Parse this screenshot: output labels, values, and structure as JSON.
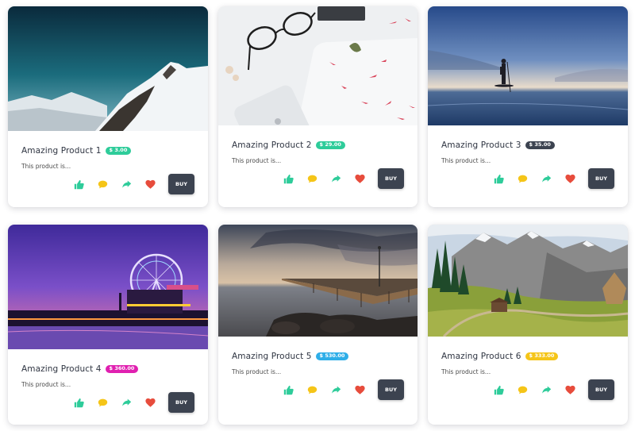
{
  "colors": {
    "like": "#2ecc9a",
    "comment": "#f5c518",
    "share": "#2ecc9a",
    "favorite": "#e74c3c",
    "buy_button": "#3c4350"
  },
  "icons": [
    "thumbs-up-icon",
    "comment-icon",
    "share-icon",
    "heart-icon"
  ],
  "products": [
    {
      "title": "Amazing Product 1",
      "price": "$ 3.00",
      "badge_color": "#2ecc9a",
      "description": "This product is...",
      "buy_label": "BUY"
    },
    {
      "title": "Amazing Product 2",
      "price": "$ 29.00",
      "badge_color": "#2ecc9a",
      "description": "This product is...",
      "buy_label": "BUY"
    },
    {
      "title": "Amazing Product 3",
      "price": "$ 35.00",
      "badge_color": "#3c4350",
      "description": "This product is...",
      "buy_label": "BUY"
    },
    {
      "title": "Amazing Product 4",
      "price": "$ 360.00",
      "badge_color": "#e020b0",
      "description": "This product is...",
      "buy_label": "BUY"
    },
    {
      "title": "Amazing Product 5",
      "price": "$ 530.00",
      "badge_color": "#2eaee8",
      "description": "This product is...",
      "buy_label": "BUY"
    },
    {
      "title": "Amazing Product 6",
      "price": "$ 333.00",
      "badge_color": "#f5c518",
      "description": "This product is...",
      "buy_label": "BUY"
    }
  ]
}
